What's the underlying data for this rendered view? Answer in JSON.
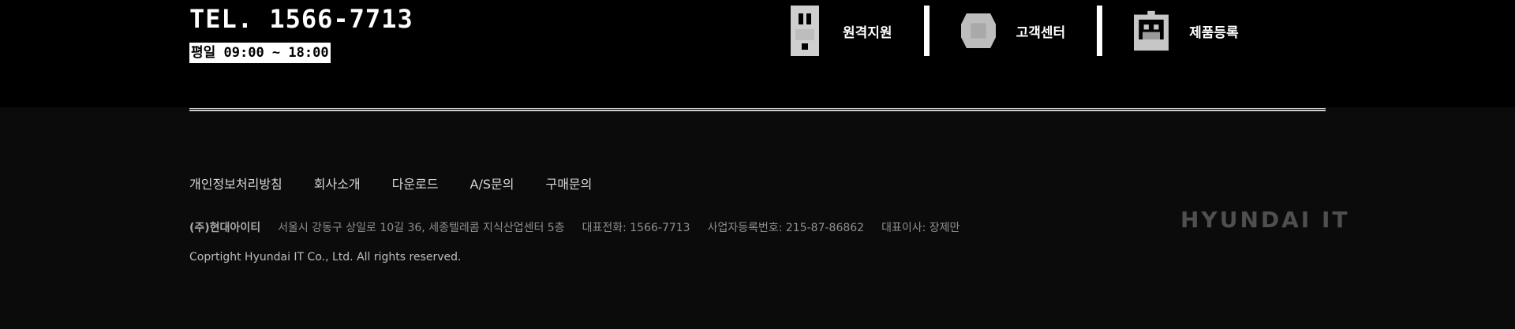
{
  "contact": {
    "tel": "TEL. 1566-7713",
    "hours": "평일 09:00 ~ 18:00"
  },
  "quick_links": [
    {
      "label": "원격지원",
      "icon": "remote-support-icon"
    },
    {
      "label": "고객센터",
      "icon": "customer-center-icon"
    },
    {
      "label": "제품등록",
      "icon": "product-register-icon"
    }
  ],
  "footer_nav": [
    "개인정보처리방침",
    "회사소개",
    "다운로드",
    "A/S문의",
    "구매문의"
  ],
  "company": {
    "name": "(주)현대아이티",
    "address": "서울시 강동구 상일로 10길 36, 세종텔레콤 지식산업센터 5층",
    "phone": "대표전화: 1566-7713",
    "business_number": "사업자등록번호: 215-87-86862",
    "ceo": "대표이사: 장제만"
  },
  "copyright": "Coprtight Hyundai IT Co., Ltd.  All rights reserved.",
  "brand": "HYUNDAI IT",
  "colors": {
    "top_band": "#000000",
    "footer_bg": "#0b0b0b",
    "brand": "#4f4f4f"
  }
}
